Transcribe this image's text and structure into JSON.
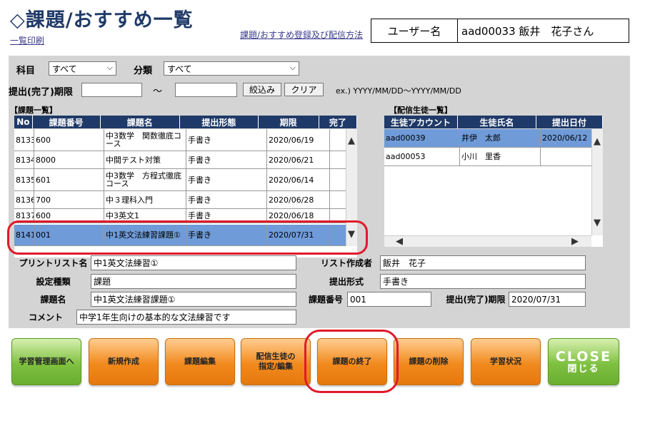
{
  "header": {
    "title": "◇課題/おすすめ一覧",
    "print_link": "一覧印刷",
    "method_link": "課題/おすすめ登録及び配信方法",
    "user_label": "ユーザー名",
    "user_value": "aad00033 飯井　花子さん"
  },
  "filters": {
    "subject_label": "科目",
    "subject_value": "すべて",
    "category_label": "分類",
    "category_value": "すべて",
    "deadline_label": "提出(完了)期限",
    "range_sep": "〜",
    "filter_button": "絞込み",
    "clear_button": "クリア",
    "format_hint": "ex.) YYYY/MM/DD〜YYYY/MM/DD"
  },
  "assignments": {
    "section_label": "【課題一覧】",
    "columns": [
      "No",
      "課題番号",
      "課題名",
      "提出形態",
      "期限",
      "完了"
    ],
    "rows": [
      {
        "no": "8133",
        "num": "600",
        "name": "中3数学　関数徹底コース",
        "form": "手書き",
        "deadline": "2020/06/19",
        "done": ""
      },
      {
        "no": "8134",
        "num": "8000",
        "name": "中間テスト対策",
        "form": "手書き",
        "deadline": "2020/06/21",
        "done": ""
      },
      {
        "no": "8135",
        "num": "601",
        "name": "中3数学　方程式徹底コース",
        "form": "手書き",
        "deadline": "2020/06/14",
        "done": ""
      },
      {
        "no": "8136",
        "num": "700",
        "name": "中３理科入門",
        "form": "手書き",
        "deadline": "2020/06/28",
        "done": ""
      },
      {
        "no": "8137",
        "num": "600",
        "name": "中3英文1",
        "form": "手書き",
        "deadline": "2020/06/18",
        "done": ""
      },
      {
        "no": "8141",
        "num": "001",
        "name": "中1英文法練習課題①",
        "form": "手書き",
        "deadline": "2020/07/31",
        "done": ""
      }
    ]
  },
  "students": {
    "section_label": "【配信生徒一覧】",
    "columns": [
      "生徒アカウント",
      "生徒氏名",
      "提出日付"
    ],
    "rows": [
      {
        "account": "aad00039",
        "name": "井伊　太郎",
        "date": "2020/06/12"
      },
      {
        "account": "aad00053",
        "name": "小川　里香",
        "date": ""
      }
    ]
  },
  "detail": {
    "print_list_label": "プリントリスト名",
    "print_list_value": "中1英文法練習①",
    "creator_label": "リスト作成者",
    "creator_value": "飯井　花子",
    "type_label": "設定種類",
    "type_value": "課題",
    "submit_form_label": "提出形式",
    "submit_form_value": "手書き",
    "task_name_label": "課題名",
    "task_name_value": "中1英文法練習課題①",
    "task_num_label": "課題番号",
    "task_num_value": "001",
    "deadline_label": "提出(完了)期限",
    "deadline_value": "2020/07/31",
    "comment_label": "コメント",
    "comment_value": "中学1年生向けの基本的な文法練習です"
  },
  "buttons": {
    "manage": "学習管理画面へ",
    "new": "新規作成",
    "edit": "課題編集",
    "assign_line1": "配信生徒の",
    "assign_line2": "指定/編集",
    "finish": "課題の終了",
    "delete": "課題の削除",
    "status": "学習状況",
    "close_en": "CLOSE",
    "close_jp": "閉じる"
  },
  "colors": {
    "header_blue": "#1f3a68",
    "selected_row": "#6f9bd8",
    "panel_gray": "#d4d4d4",
    "orange_button": "#f28a1e",
    "green_button": "#7fc140",
    "highlight_red": "#e0192b"
  }
}
